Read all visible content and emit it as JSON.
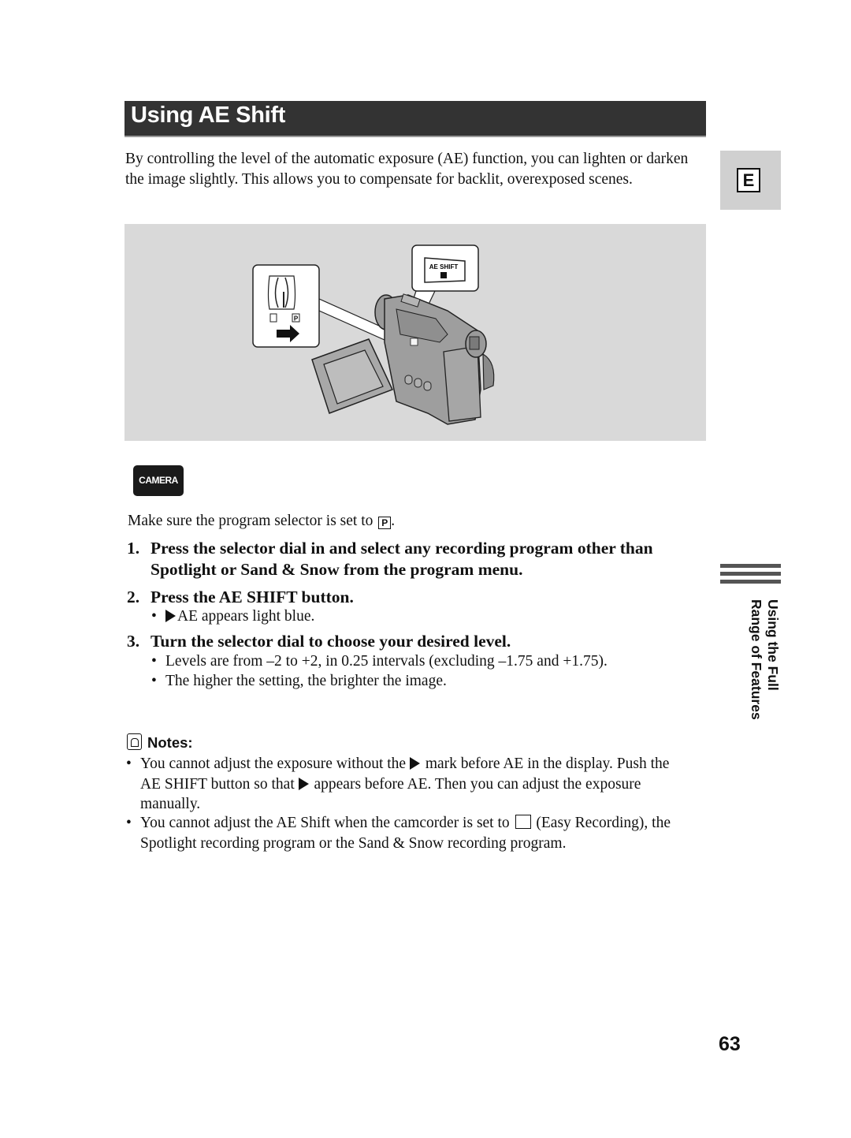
{
  "header": {
    "title": "Using AE Shift"
  },
  "intro": "By controlling the level of the automatic exposure (AE) function, you can lighten or darken the image slightly. This allows you to compensate for backlit, overexposed scenes.",
  "language_tab": {
    "letter": "E"
  },
  "figure": {
    "callout_button_label": "AE SHIFT",
    "selector_positions": [
      "easy",
      "P"
    ],
    "selector_label_p": "P"
  },
  "mode_badge": "CAMERA",
  "prerequisite": {
    "text": "Make sure the program selector is set to",
    "symbol": "P",
    "end": "."
  },
  "steps": [
    {
      "num": "1.",
      "text": "Press the selector dial in and select any recording program other than Spotlight or Sand & Snow from the program menu.",
      "bullets": []
    },
    {
      "num": "2.",
      "text": "Press the AE SHIFT button.",
      "bullets": [
        "AE appears light blue."
      ]
    },
    {
      "num": "3.",
      "text": "Turn the selector dial to choose your desired level.",
      "bullets": [
        "Levels are from –2 to +2, in 0.25 intervals (excluding –1.75 and +1.75).",
        "The higher the setting, the brighter the image."
      ]
    }
  ],
  "notes": {
    "heading": "Notes:",
    "items": [
      {
        "part1": "You cannot adjust the exposure without the",
        "part2": "mark before AE in the display. Push the AE SHIFT button so that",
        "part3": "appears before AE. Then you can adjust the exposure manually."
      },
      {
        "part1": "You cannot adjust the AE Shift when the camcorder is set to",
        "part2": "(Easy Recording), the Spotlight recording program or the Sand & Snow recording program."
      }
    ]
  },
  "side_section": {
    "line1": "Using the Full",
    "line2": "Range of Features"
  },
  "page_number": "63",
  "bullet_char": "•"
}
